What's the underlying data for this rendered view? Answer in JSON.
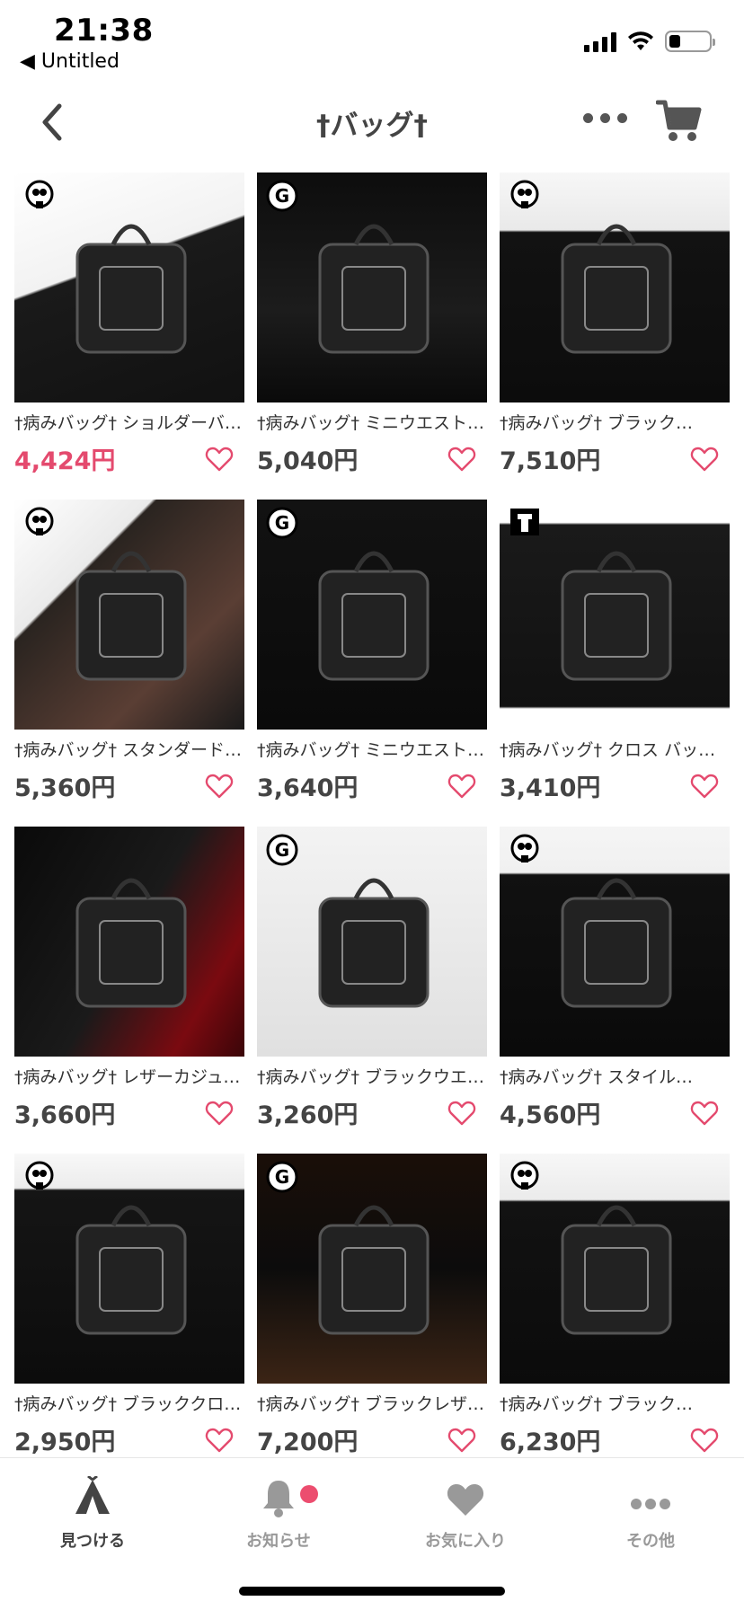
{
  "status": {
    "time": "21:38",
    "back_app": "◀ Untitled"
  },
  "header": {
    "title": "†バッグ†"
  },
  "products": [
    {
      "title": "†病みバッグ† ショルダーバッグ",
      "price": "4,424円",
      "highlight": true,
      "brand": "devil"
    },
    {
      "title": "†病みバッグ† ミニウエストバッグ",
      "price": "5,040円",
      "highlight": false,
      "brand": "g"
    },
    {
      "title": "†病みバッグ† ブラック…",
      "price": "7,510円",
      "highlight": false,
      "brand": "devil"
    },
    {
      "title": "†病みバッグ† スタンダードバッグ",
      "price": "5,360円",
      "highlight": false,
      "brand": "devil"
    },
    {
      "title": "†病みバッグ† ミニウエストバッグ",
      "price": "3,640円",
      "highlight": false,
      "brand": "g"
    },
    {
      "title": "†病みバッグ† クロス バックパック",
      "price": "3,410円",
      "highlight": false,
      "brand": "steel"
    },
    {
      "title": "†病みバッグ† レザーカジュアルバッグ",
      "price": "3,660円",
      "highlight": false,
      "brand": "none"
    },
    {
      "title": "†病みバッグ† ブラックウエストバッグ",
      "price": "3,260円",
      "highlight": false,
      "brand": "g"
    },
    {
      "title": "†病みバッグ† スタイル…",
      "price": "4,560円",
      "highlight": false,
      "brand": "devil"
    },
    {
      "title": "†病みバッグ† ブラッククロスバッグ",
      "price": "2,950円",
      "highlight": false,
      "brand": "devil"
    },
    {
      "title": "†病みバッグ† ブラックレザーバッグ",
      "price": "7,200円",
      "highlight": false,
      "brand": "g"
    },
    {
      "title": "†病みバッグ† ブラック…",
      "price": "6,230円",
      "highlight": false,
      "brand": "devil"
    }
  ],
  "tabs": [
    {
      "label": "見つける",
      "icon": "tent-icon",
      "active": true
    },
    {
      "label": "お知らせ",
      "icon": "bell-icon",
      "active": false
    },
    {
      "label": "お気に入り",
      "icon": "heart-icon",
      "active": false
    },
    {
      "label": "その他",
      "icon": "more-icon",
      "active": false
    }
  ],
  "colors": {
    "accent": "#e44a6e",
    "badge": "#ec4d6f",
    "text": "#444444",
    "muted": "#999999"
  }
}
